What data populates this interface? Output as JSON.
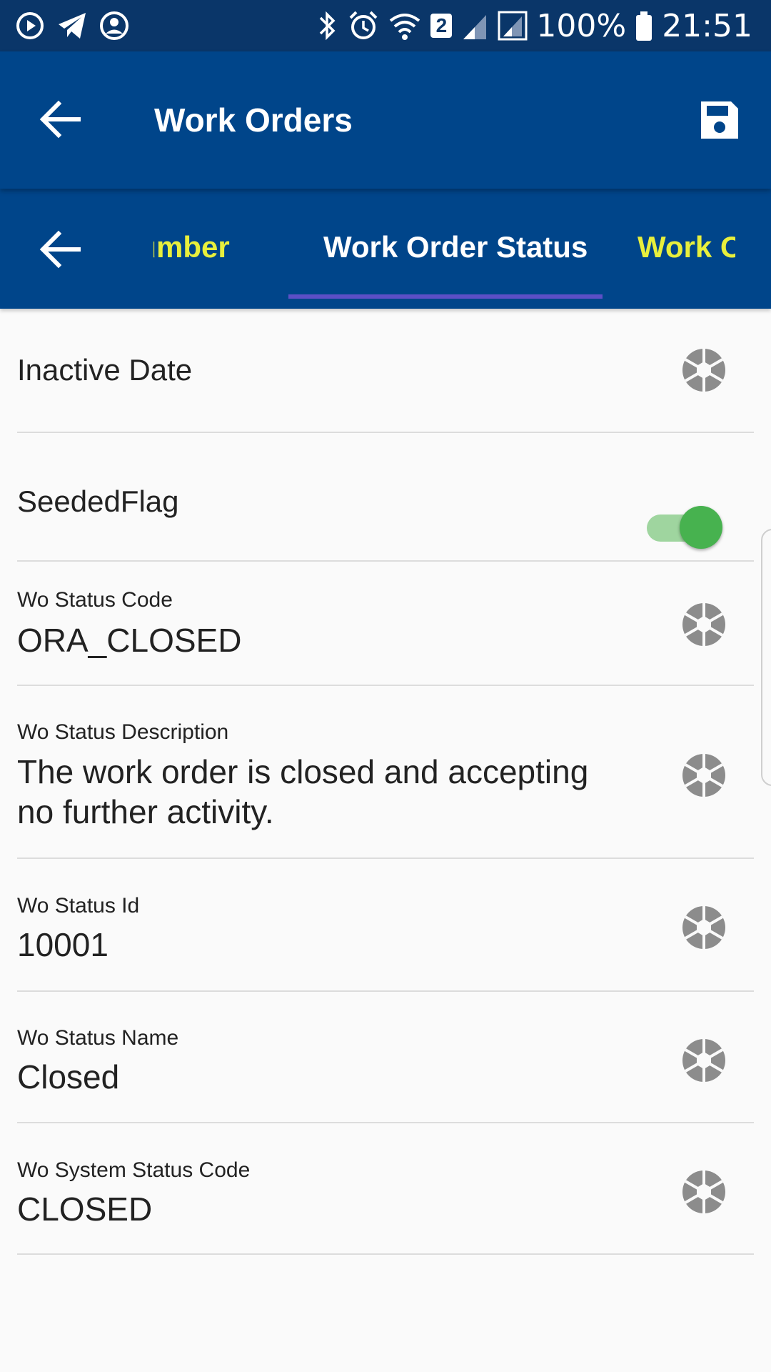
{
  "status_bar": {
    "battery": "100%",
    "time": "21:51",
    "sim_badge": "2",
    "icons": [
      "media-play-icon",
      "telegram-icon",
      "account-circle-icon",
      "bluetooth-icon",
      "alarm-icon",
      "wifi-icon",
      "signal-icon",
      "roaming-signal-icon",
      "battery-icon"
    ]
  },
  "app_bar": {
    "title": "Work Orders",
    "back_icon": "arrow-back-icon",
    "save_icon": "save-floppy-icon"
  },
  "tabs": {
    "items": [
      "Number",
      "Work Order Status",
      "Work Or"
    ],
    "active_index": 1,
    "colors": {
      "active": "#ffffff",
      "inactive": "#e8ef3c",
      "indicator": "#5c4fc6"
    }
  },
  "fields": {
    "inactive_date": {
      "label": "Inactive Date"
    },
    "seeded_flag": {
      "label": "SeededFlag",
      "on": true
    },
    "wo_status_code": {
      "label": "Wo Status Code",
      "value": "ORA_CLOSED"
    },
    "wo_status_description": {
      "label": "Wo Status Description",
      "value_line1": "The work order is closed and accepting",
      "value_line2": "no further activity."
    },
    "wo_status_id": {
      "label": "Wo Status Id",
      "value": "10001"
    },
    "wo_status_name": {
      "label": "Wo Status Name",
      "value": "Closed"
    },
    "wo_system_status_code": {
      "label": "Wo System Status Code",
      "value": "CLOSED"
    }
  },
  "colors": {
    "status_bar_bg": "#0a3669",
    "app_bar_bg": "#00458a",
    "toggle_on": "#47b24f",
    "icon_gray": "#8c8c8c"
  }
}
